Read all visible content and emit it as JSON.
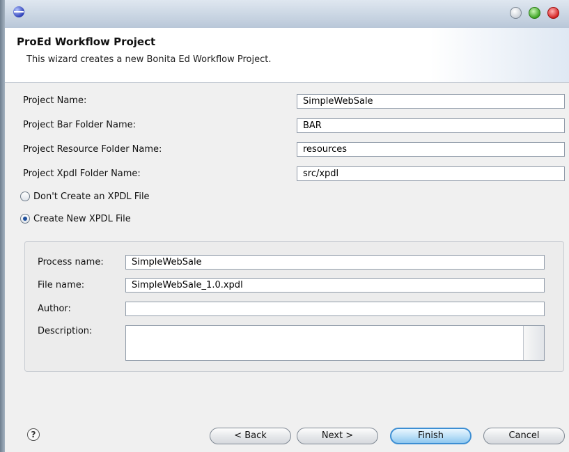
{
  "wizard": {
    "title": "ProEd Workflow Project",
    "description": "This wizard creates a new Bonita Ed Workflow Project."
  },
  "project": {
    "name_label": "Project Name:",
    "name_value": "SimpleWebSale",
    "bar_label": "Project Bar Folder Name:",
    "bar_value": "BAR",
    "resource_label": "Project Resource Folder Name:",
    "resource_value": "resources",
    "xpdl_label": "Project Xpdl Folder Name:",
    "xpdl_value": "src/xpdl"
  },
  "xpdl_options": {
    "dont_create_label": "Don't Create an XPDL File",
    "dont_create_selected": false,
    "create_new_label": "Create New XPDL File",
    "create_new_selected": true
  },
  "xpdl_file": {
    "process_label": "Process name:",
    "process_value": "SimpleWebSale",
    "file_label": "File name:",
    "file_value": "SimpleWebSale_1.0.xpdl",
    "author_label": "Author:",
    "author_value": "",
    "description_label": "Description:",
    "description_value": ""
  },
  "buttons": {
    "help": "?",
    "back": "< Back",
    "next": "Next >",
    "finish": "Finish",
    "cancel": "Cancel"
  },
  "icons": {
    "app": "eclipse-icon",
    "help": "help-icon",
    "minimize": "minimize-icon",
    "maximize": "maximize-icon",
    "close": "close-icon"
  },
  "colors": {
    "finish_border": "#3c8ed3",
    "close_button": "#d11a1a",
    "maximize_button": "#36a11d"
  }
}
